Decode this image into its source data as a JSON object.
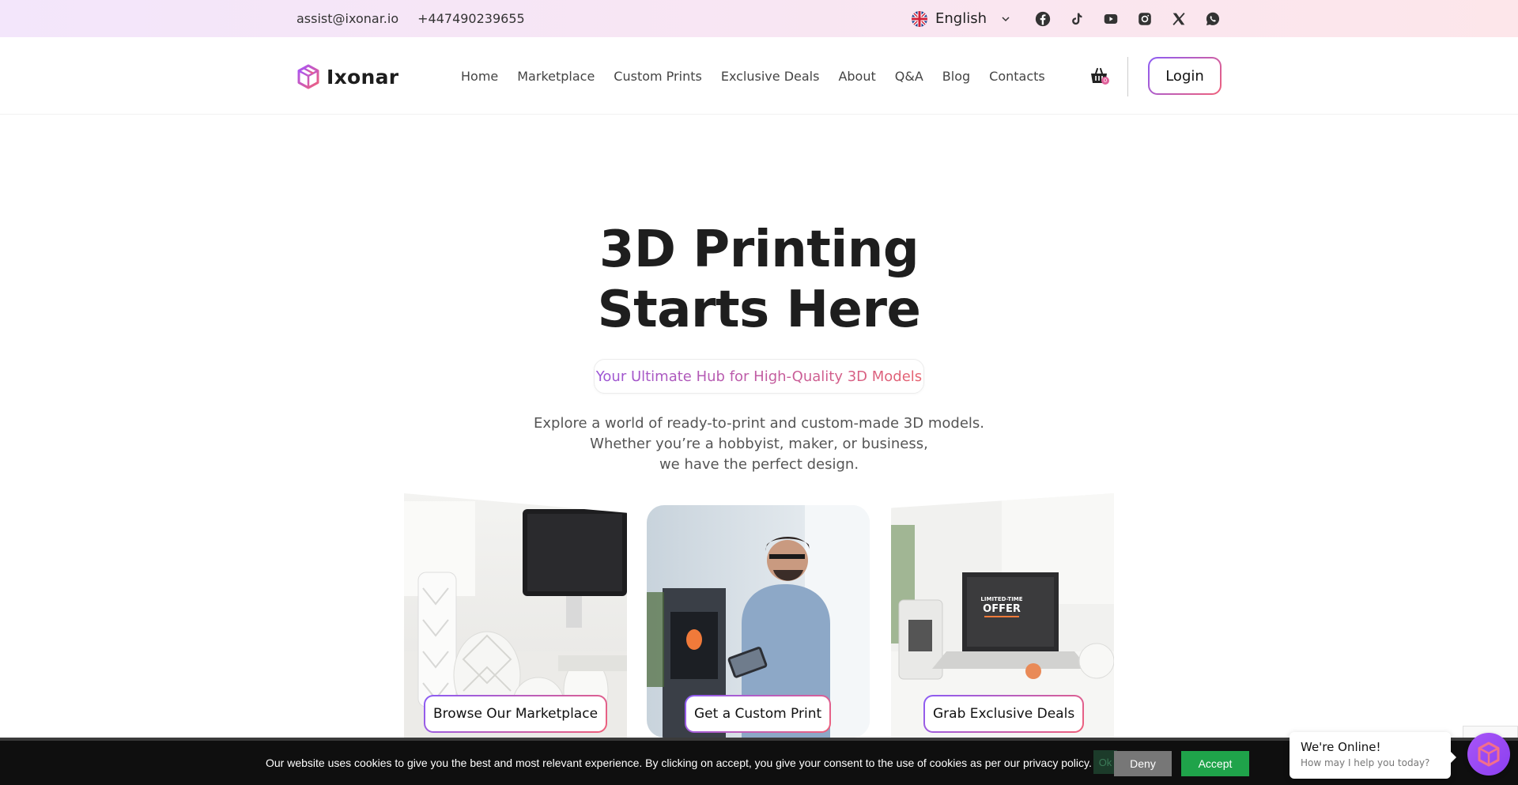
{
  "topbar": {
    "email": "assist@ixonar.io",
    "phone": "+447490239655",
    "language": "English",
    "socials": [
      "facebook-icon",
      "tiktok-icon",
      "youtube-icon",
      "instagram-icon",
      "x-icon",
      "whatsapp-icon"
    ]
  },
  "header": {
    "logo_text": "Ixonar",
    "nav": [
      "Home",
      "Marketplace",
      "Custom Prints",
      "Exclusive Deals",
      "About",
      "Q&A",
      "Blog",
      "Contacts"
    ],
    "cart_count": "0",
    "login_label": "Login"
  },
  "hero": {
    "title_line1": "3D Printing",
    "title_line2": "Starts Here",
    "tagline": "Your Ultimate Hub for High-Quality 3D Models",
    "desc_line1": "Explore a world of ready-to-print and custom-made 3D models.",
    "desc_line2": "Whether you’re a hobbyist, maker, or business,",
    "desc_line3": "we have the perfect design."
  },
  "cards": [
    {
      "button": "Browse Our Marketplace"
    },
    {
      "button": "Get a Custom Print"
    },
    {
      "button": "Grab Exclusive Deals",
      "screen_text_1": "LIMITED-TIME",
      "screen_text_2": "OFFER"
    }
  ],
  "cookie": {
    "text": "Our website uses cookies to give you the best and most relevant experience. By clicking on accept, you give your consent to the use of cookies as per our privacy policy.",
    "ghost": "Ok",
    "deny": "Deny",
    "accept": "Accept"
  },
  "chat": {
    "title": "We're Online!",
    "subtitle": "How may I help you today?"
  },
  "colors": {
    "accent_purple": "#8b5cf6",
    "accent_pink": "#f0607a",
    "accept_green": "#1fa34a"
  }
}
